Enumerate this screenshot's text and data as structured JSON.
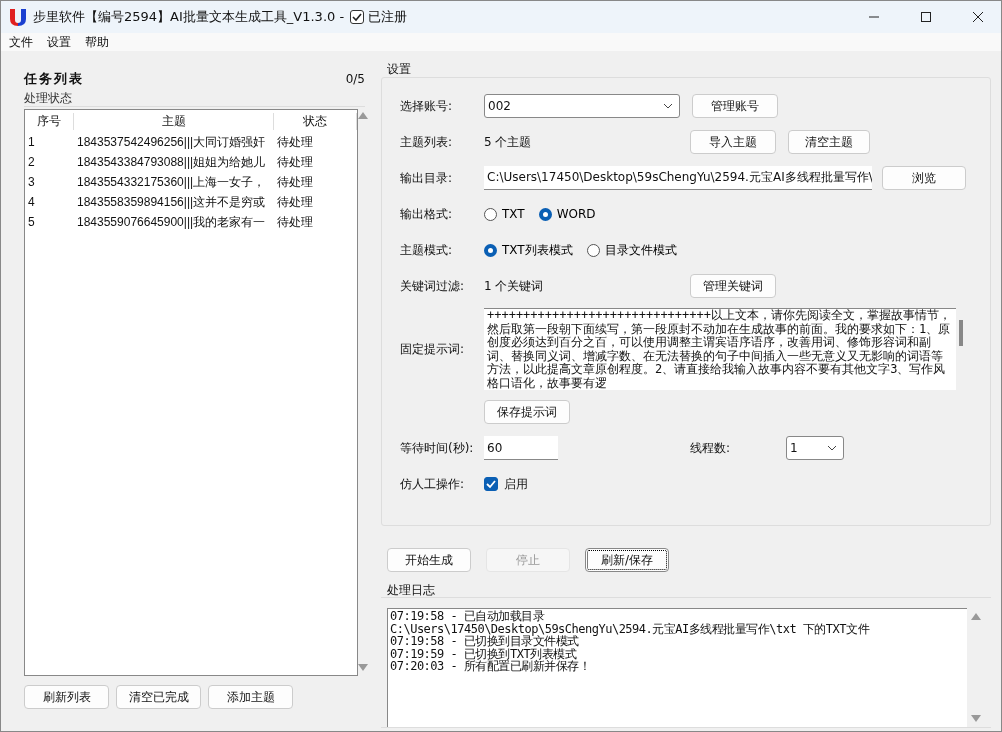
{
  "window": {
    "title": "步里软件【编号2594】AI批量文本生成工具_V1.3.0 -",
    "registered": {
      "label": "已注册",
      "checked": true
    }
  },
  "menu": [
    "文件",
    "设置",
    "帮助"
  ],
  "task_list": {
    "title": "任务列表",
    "count": "0/5",
    "group_title": "处理状态",
    "columns": [
      "序号",
      "主题",
      "状态"
    ],
    "rows": [
      {
        "cells": [
          "1",
          "1843537542496256|||大同订婚强奸",
          "待处理"
        ]
      },
      {
        "cells": [
          "2",
          "1843543384793088|||姐姐为给她儿",
          "待处理"
        ]
      },
      {
        "cells": [
          "3",
          "1843554332175360|||上海一女子，",
          "待处理"
        ]
      },
      {
        "cells": [
          "4",
          "1843558359894156|||这并不是穷或",
          "待处理"
        ]
      },
      {
        "cells": [
          "5",
          "1843559076645900|||我的老家有一",
          "待处理"
        ]
      }
    ],
    "buttons": [
      "刷新列表",
      "清空已完成",
      "添加主题"
    ]
  },
  "settings": {
    "title": "设置",
    "account": {
      "label": "选择账号:",
      "value": "002",
      "button": "管理账号"
    },
    "topics": {
      "label": "主题列表:",
      "value": "5 个主题",
      "buttons": [
        "导入主题",
        "清空主题"
      ]
    },
    "output_dir": {
      "label": "输出目录:",
      "value": "C:\\Users\\17450\\Desktop\\59sChengYu\\2594.元宝AI多线程批量写作\\",
      "button": "浏览"
    },
    "output_format": {
      "label": "输出格式:",
      "options": [
        {
          "label": "TXT",
          "selected": false
        },
        {
          "label": "WORD",
          "selected": true
        }
      ]
    },
    "topic_mode": {
      "label": "主题模式:",
      "options": [
        {
          "label": "TXT列表模式",
          "selected": true
        },
        {
          "label": "目录文件模式",
          "selected": false
        }
      ]
    },
    "keywords": {
      "label": "关键词过滤:",
      "value": "1 个关键词",
      "button": "管理关键词"
    },
    "prompt": {
      "label": "固定提示词:",
      "value": "+++++++++++++++++++++++++++++++以上文本，请你先阅读全文，掌握故事情节，然后取第一段朝下面续写，第一段原封不动加在生成故事的前面。我的要求如下：1、原创度必须达到百分之百，可以使用调整主谓宾语序语序，改善用词、修饰形容词和副词、替换同义词、增减字数、在无法替换的句子中间插入一些无意义又无影响的词语等方法，以此提高文章原创程度。2、请直接给我输入故事内容不要有其他文字3、写作风格口语化，故事要有逻",
      "button": "保存提示词"
    },
    "wait": {
      "label": "等待时间(秒):",
      "value": "60"
    },
    "threads": {
      "label": "线程数:",
      "value": "1"
    },
    "human": {
      "label": "仿人工操作:",
      "checkbox": "启用",
      "checked": true
    }
  },
  "actions": [
    {
      "label": "开始生成",
      "disabled": false,
      "focused": false
    },
    {
      "label": "停止",
      "disabled": true,
      "focused": false
    },
    {
      "label": "刷新/保存",
      "disabled": false,
      "focused": true
    }
  ],
  "log": {
    "title": "处理日志",
    "lines": [
      "07:19:58 - 已自动加载目录",
      "C:\\Users\\17450\\Desktop\\59sChengYu\\2594.元宝AI多线程批量写作\\txt 下的TXT文件",
      "07:19:58 - 已切换到目录文件模式",
      "07:19:59 - 已切换到TXT列表模式",
      "07:20:03 - 所有配置已刷新并保存！"
    ]
  }
}
